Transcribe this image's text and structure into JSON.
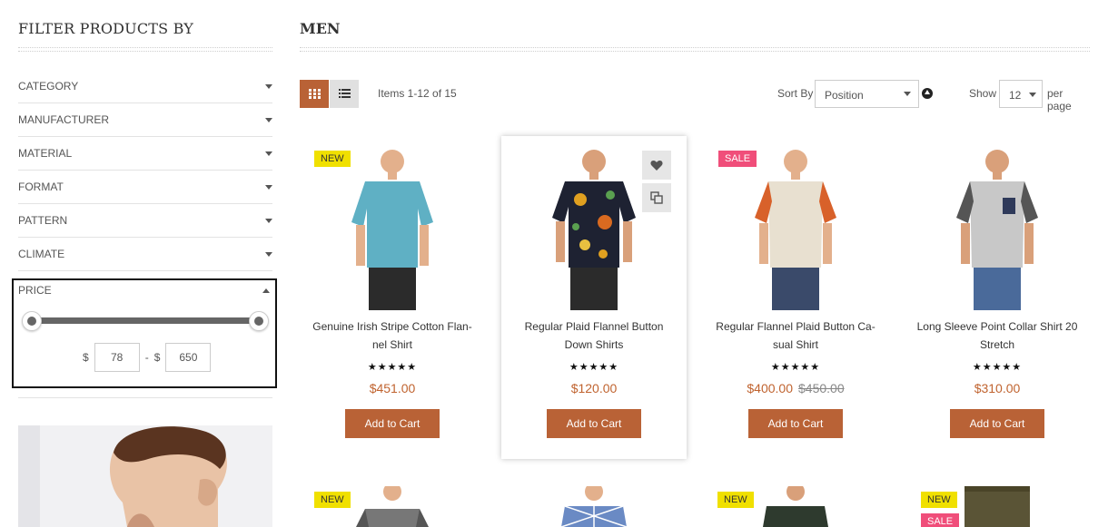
{
  "sidebar": {
    "title": "FILTER PRODUCTS BY",
    "filters": [
      {
        "label": "CATEGORY"
      },
      {
        "label": "MANUFACTURER"
      },
      {
        "label": "MATERIAL"
      },
      {
        "label": "FORMAT"
      },
      {
        "label": "PATTERN"
      },
      {
        "label": "CLIMATE"
      }
    ],
    "price": {
      "label": "PRICE",
      "currency": "$",
      "separator": "-",
      "min": "78",
      "max": "650"
    }
  },
  "main": {
    "title": "MEN",
    "items_count": "Items 1-12 of 15",
    "sort_label": "Sort By",
    "sort_value": "Position",
    "show_label": "Show",
    "show_value": "12",
    "per_page_label": "per page"
  },
  "products": [
    {
      "name": "Genuine Irish Stripe Cotton Flan-nel Shirt",
      "price": "$451.00",
      "old_price": "",
      "rating": "★★★★★",
      "badge": "NEW",
      "button": "Add to Cart",
      "shirt_color": "#5fb0c4",
      "sleeve_color": "#5fb0c4",
      "pants_color": "#2b2b2b"
    },
    {
      "name": "Regular Plaid Flannel Button Down Shirts",
      "price": "$120.00",
      "old_price": "",
      "rating": "★★★★★",
      "badge": "",
      "button": "Add to Cart",
      "shirt_color": "#1e2232",
      "sleeve_color": "#1e2232",
      "pants_color": "#2b2b2b"
    },
    {
      "name": "Regular Flannel Plaid Button Ca-sual Shirt",
      "price": "$400.00",
      "old_price": "$450.00",
      "rating": "★★★★★",
      "badge": "SALE",
      "button": "Add to Cart",
      "shirt_color": "#e8e0d0",
      "sleeve_color": "#d8612a",
      "pants_color": "#3a4a6a"
    },
    {
      "name": "Long Sleeve Point Collar Shirt 20 Stretch",
      "price": "$310.00",
      "old_price": "",
      "rating": "★★★★★",
      "badge": "",
      "button": "Add to Cart",
      "shirt_color": "#c8c8c8",
      "sleeve_color": "#555555",
      "pants_color": "#4a6a9a"
    }
  ],
  "row2_badges": [
    {
      "new": "NEW",
      "sale": ""
    },
    {
      "new": "",
      "sale": ""
    },
    {
      "new": "NEW",
      "sale": ""
    },
    {
      "new": "NEW",
      "sale": "SALE"
    }
  ],
  "colors": {
    "accent": "#b96236",
    "price": "#c0632f",
    "badge_new": "#f0e000",
    "badge_sale": "#f04e7a"
  }
}
